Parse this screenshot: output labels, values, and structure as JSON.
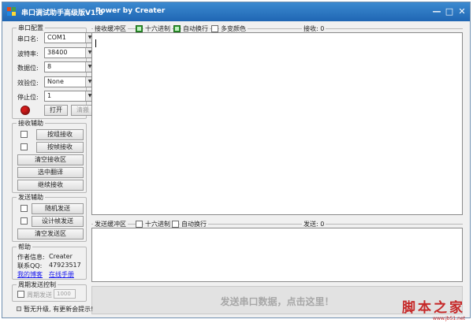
{
  "window": {
    "title": "串口调试助手高级版V1.6",
    "subtitle": "Power by Creater",
    "minimize": "—",
    "maximize": "□",
    "close": "✕"
  },
  "serial_config": {
    "title": "串口配置",
    "port_label": "串口名:",
    "port_value": "COM1",
    "baud_label": "波特率:",
    "baud_value": "38400",
    "databits_label": "数据位:",
    "databits_value": "8",
    "parity_label": "效验位:",
    "parity_value": "None",
    "stopbits_label": "停止位:",
    "stopbits_value": "1",
    "open_button": "打开",
    "clear_button": "清搬",
    "status_led_color": "#d21b1b"
  },
  "receive_assist": {
    "title": "接收辅助",
    "by_line": "按组接收",
    "by_frame": "按帧接收",
    "clear_receive": "清空接收区",
    "flip_selected": "选中翻译",
    "continue_receive": "继续接收"
  },
  "send_assist": {
    "title": "发送辅助",
    "random_send": "随机发送",
    "frame_send": "设计帧发送",
    "clear_send": "清空发送区"
  },
  "help": {
    "title": "帮助",
    "author_label": "作者信息:",
    "author_value": "Creater",
    "qq_label": "联系QQ:",
    "qq_value": "47923517",
    "blog_link": "我的博客",
    "manual_link": "在线手册"
  },
  "periodic_send": {
    "title": "周期发送控制",
    "checkbox_label": "周期发送",
    "interval_value": "1000"
  },
  "receive_area": {
    "label": "接收缓冲区",
    "hex_label": "十六进制",
    "wrap_label": "自动换行",
    "color_label": "多变颜色",
    "count_label": "接收: 0",
    "hex_checked": true,
    "wrap_checked": true,
    "color_checked": false
  },
  "send_area": {
    "label": "发送缓冲区",
    "hex_label": "十六进制",
    "wrap_label": "自动换行",
    "count_label": "发送: 0"
  },
  "send_bar": {
    "label": "发送串口数据，点击这里！"
  },
  "status_bar": {
    "text": "暂无升级, 有更新会提示!"
  },
  "watermark": {
    "text": "脚本之家",
    "url": "www.jb51.net"
  }
}
